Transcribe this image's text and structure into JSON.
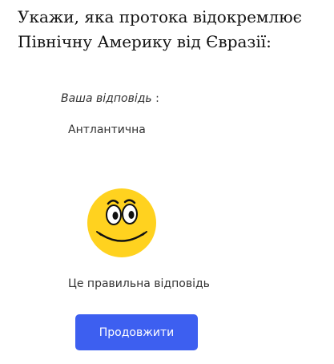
{
  "question": {
    "line1": "Укажи, яка протока відокремлює",
    "line2": "Північну Америку від Євразії:"
  },
  "answer": {
    "label": "Ваша відповідь",
    "separator": " :",
    "value": "Антлантична"
  },
  "feedback": {
    "icon": "smiley-face-icon",
    "icon_color": "#ffd21f",
    "text": "Це правильна відповідь"
  },
  "actions": {
    "continue_label": "Продовжити",
    "continue_color": "#3d5ff0"
  }
}
